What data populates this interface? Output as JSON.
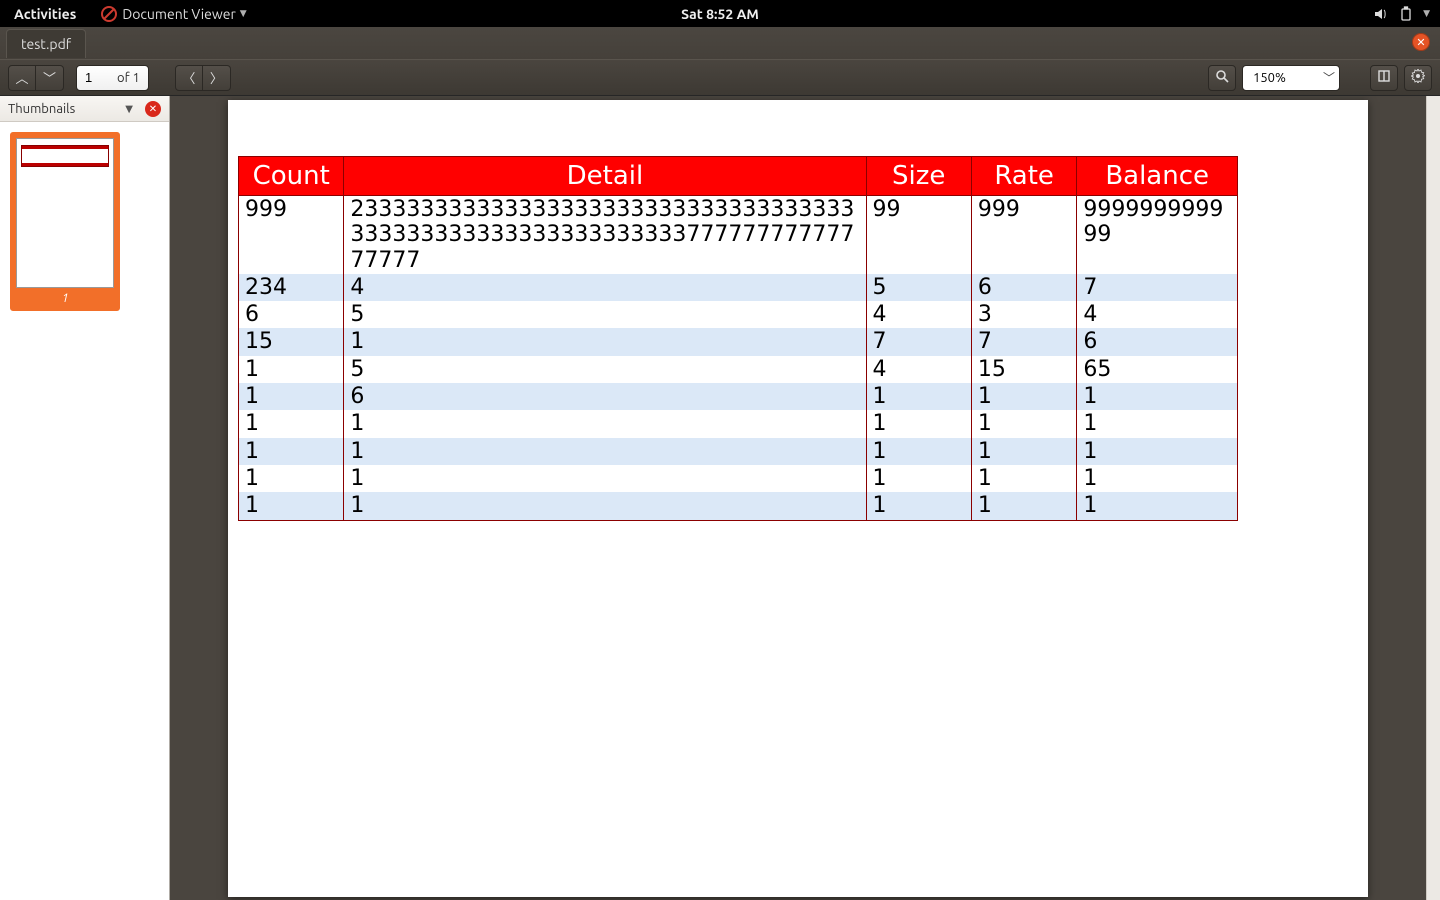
{
  "topbar": {
    "activities": "Activities",
    "app_name": "Document Viewer",
    "clock": "Sat  8:52 AM"
  },
  "window": {
    "tab_title": "test.pdf"
  },
  "toolbar": {
    "page_current": "1",
    "page_total_label": "of 1",
    "zoom_label": "150%"
  },
  "sidebar": {
    "title": "Thumbnails",
    "thumb_number": "1"
  },
  "table": {
    "headers": [
      "Count",
      "Detail",
      "Size",
      "Rate",
      "Balance"
    ],
    "rows": [
      [
        "999",
        "23333333333333333333333333333333333333333333333333333333333377777777777777777",
        "99",
        "999",
        "999999999999"
      ],
      [
        "234",
        "4",
        "5",
        "6",
        "7"
      ],
      [
        "6",
        "5",
        "4",
        "3",
        "4"
      ],
      [
        "15",
        "1",
        "7",
        "7",
        "6"
      ],
      [
        "1",
        "5",
        "4",
        "15",
        "65"
      ],
      [
        "1",
        "6",
        "1",
        "1",
        "1"
      ],
      [
        "1",
        "1",
        "1",
        "1",
        "1"
      ],
      [
        "1",
        "1",
        "1",
        "1",
        "1"
      ],
      [
        "1",
        "1",
        "1",
        "1",
        "1"
      ],
      [
        "1",
        "1",
        "1",
        "1",
        "1"
      ]
    ]
  }
}
